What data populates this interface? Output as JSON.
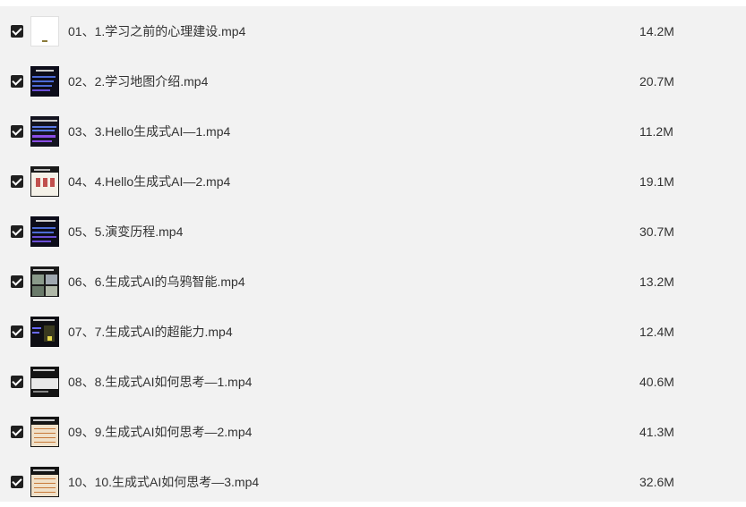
{
  "files": [
    {
      "name": "01、1.学习之前的心理建设.mp4",
      "size": "14.2M",
      "thumb": "white"
    },
    {
      "name": "02、2.学习地图介绍.mp4",
      "size": "20.7M",
      "thumb": "dark-blue"
    },
    {
      "name": "03、3.Hello生成式AI—1.mp4",
      "size": "11.2M",
      "thumb": "dark-purple"
    },
    {
      "name": "04、4.Hello生成式AI—2.mp4",
      "size": "19.1M",
      "thumb": "white-diagram"
    },
    {
      "name": "05、5.演变历程.mp4",
      "size": "30.7M",
      "thumb": "dark-blue"
    },
    {
      "name": "06、6.生成式AI的乌鸦智能.mp4",
      "size": "13.2M",
      "thumb": "photo-grid"
    },
    {
      "name": "07、7.生成式AI的超能力.mp4",
      "size": "12.4M",
      "thumb": "dark-yellow"
    },
    {
      "name": "08、8.生成式AI如何思考—1.mp4",
      "size": "40.6M",
      "thumb": "dark-white"
    },
    {
      "name": "09、9.生成式AI如何思考—2.mp4",
      "size": "41.3M",
      "thumb": "dark-table"
    },
    {
      "name": "10、10.生成式AI如何思考—3.mp4",
      "size": "32.6M",
      "thumb": "dark-table"
    }
  ]
}
